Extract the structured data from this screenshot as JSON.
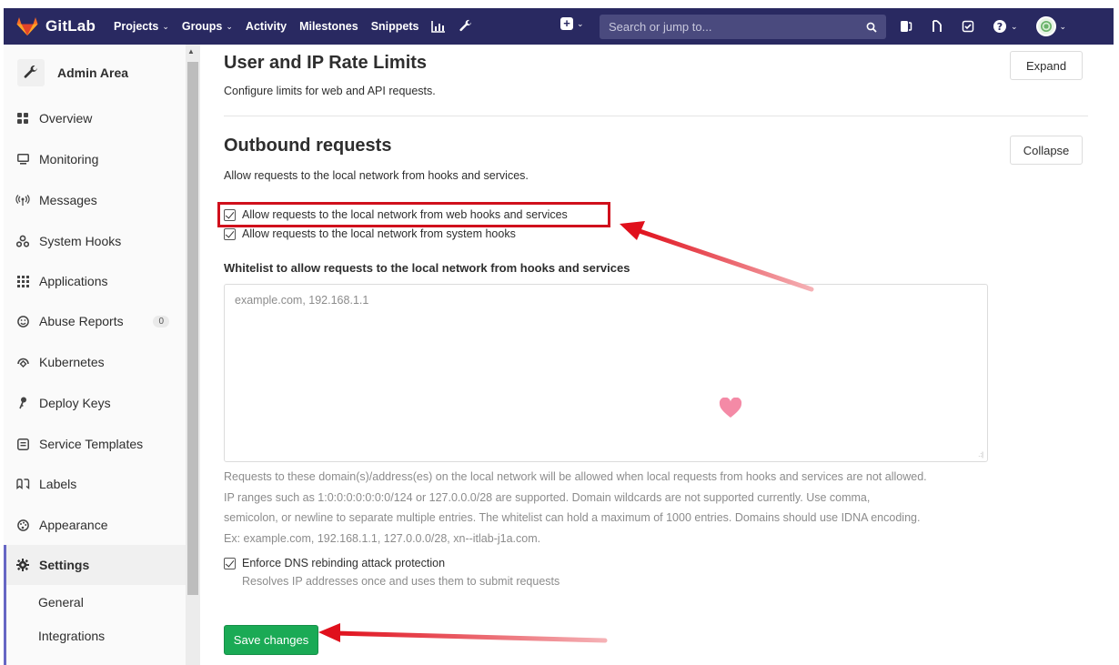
{
  "nav": {
    "brand": "GitLab",
    "links": [
      {
        "label": "Projects",
        "dropdown": true
      },
      {
        "label": "Groups",
        "dropdown": true
      },
      {
        "label": "Activity",
        "dropdown": false
      },
      {
        "label": "Milestones",
        "dropdown": false
      },
      {
        "label": "Snippets",
        "dropdown": false
      }
    ],
    "search_placeholder": "Search or jump to...",
    "icons": [
      "chart-icon",
      "wrench-icon",
      "plus-icon",
      "search-icon",
      "todos-icon",
      "merge-request-icon",
      "issues-icon",
      "help-icon",
      "avatar"
    ]
  },
  "sidebar": {
    "header": "Admin Area",
    "items": [
      {
        "label": "Overview",
        "icon": "overview-icon"
      },
      {
        "label": "Monitoring",
        "icon": "monitor-icon"
      },
      {
        "label": "Messages",
        "icon": "broadcast-icon"
      },
      {
        "label": "System Hooks",
        "icon": "hook-icon"
      },
      {
        "label": "Applications",
        "icon": "applications-icon"
      },
      {
        "label": "Abuse Reports",
        "icon": "smiley-icon",
        "badge": "0"
      },
      {
        "label": "Kubernetes",
        "icon": "cloud-icon"
      },
      {
        "label": "Deploy Keys",
        "icon": "key-icon"
      },
      {
        "label": "Service Templates",
        "icon": "template-icon"
      },
      {
        "label": "Labels",
        "icon": "labels-icon"
      },
      {
        "label": "Appearance",
        "icon": "palette-icon"
      },
      {
        "label": "Settings",
        "icon": "gear-icon",
        "active": true
      }
    ],
    "sub_items": [
      "General",
      "Integrations"
    ]
  },
  "rate_limits": {
    "title": "User and IP Rate Limits",
    "description": "Configure limits for web and API requests.",
    "button": "Expand"
  },
  "outbound": {
    "title": "Outbound requests",
    "description": "Allow requests to the local network from hooks and services.",
    "button": "Collapse",
    "checkbox_web_hooks": "Allow requests to the local network from web hooks and services",
    "checkbox_web_hooks_checked": true,
    "checkbox_system_hooks": "Allow requests to the local network from system hooks",
    "checkbox_system_hooks_checked": true,
    "whitelist_label": "Whitelist to allow requests to the local network from hooks and services",
    "whitelist_placeholder": "example.com, 192.168.1.1",
    "whitelist_value": "",
    "help_lines": [
      "Requests to these domain(s)/address(es) on the local network will be allowed when local requests from hooks and services are not allowed.",
      "IP ranges such as 1:0:0:0:0:0:0:0/124 or 127.0.0.0/28 are supported. Domain wildcards are not supported currently. Use comma,",
      "semicolon, or newline to separate multiple entries. The whitelist can hold a maximum of 1000 entries. Domains should use IDNA encoding.",
      "Ex: example.com, 192.168.1.1, 127.0.0.0/28, xn--itlab-j1a.com."
    ],
    "dns_checkbox": "Enforce DNS rebinding attack protection",
    "dns_checked": true,
    "dns_help": "Resolves IP addresses once and uses them to submit requests",
    "save_button": "Save changes"
  },
  "colors": {
    "nav_bg": "#292961",
    "annotation_red": "#d0101c",
    "save_green": "#1aaa55",
    "active_indicator": "#6666c4"
  }
}
